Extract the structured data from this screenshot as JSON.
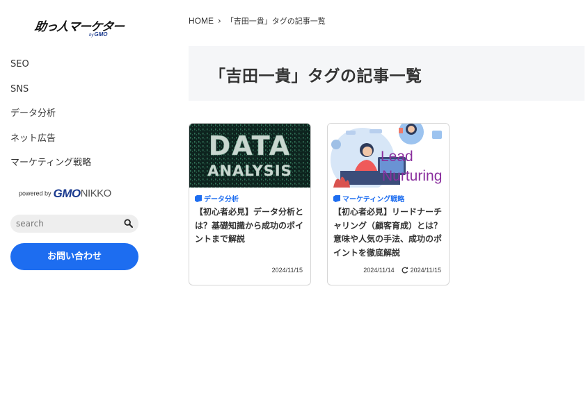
{
  "sidebar": {
    "logo": {
      "main": "助っ人マーケター",
      "by": "by",
      "brand": "GMO"
    },
    "nav": [
      "SEO",
      "SNS",
      "データ分析",
      "ネット広告",
      "マーケティング戦略"
    ],
    "powered": {
      "prefix": "powered by",
      "gmo": "GMO",
      "nikko": "NIKKO"
    },
    "search": {
      "placeholder": "search"
    },
    "contact_label": "お問い合わせ"
  },
  "breadcrumb": {
    "home": "HOME",
    "sep": "›",
    "current": "「吉田一貴」タグの記事一覧"
  },
  "page_title": "「吉田一貴」タグの記事一覧",
  "colors": {
    "accent": "#1d6df0",
    "title_bg": "#f5f6f8",
    "logo_blue": "#1a3a8f"
  },
  "cards": [
    {
      "thumb_text": [
        "DATA",
        "ANALYSIS"
      ],
      "category": "データ分析",
      "title": "【初心者必見】データ分析とは？基礎知識から成功のポイントまで解説",
      "published": "2024/11/15"
    },
    {
      "thumb_text": [
        "Lead",
        "Nurturing"
      ],
      "category": "マーケティング戦略",
      "title": "【初心者必見】リードナーチャリング（顧客育成）とは？意味や人気の手法、成功のポイントを徹底解説",
      "published": "2024/11/14",
      "updated": "2024/11/15"
    }
  ]
}
